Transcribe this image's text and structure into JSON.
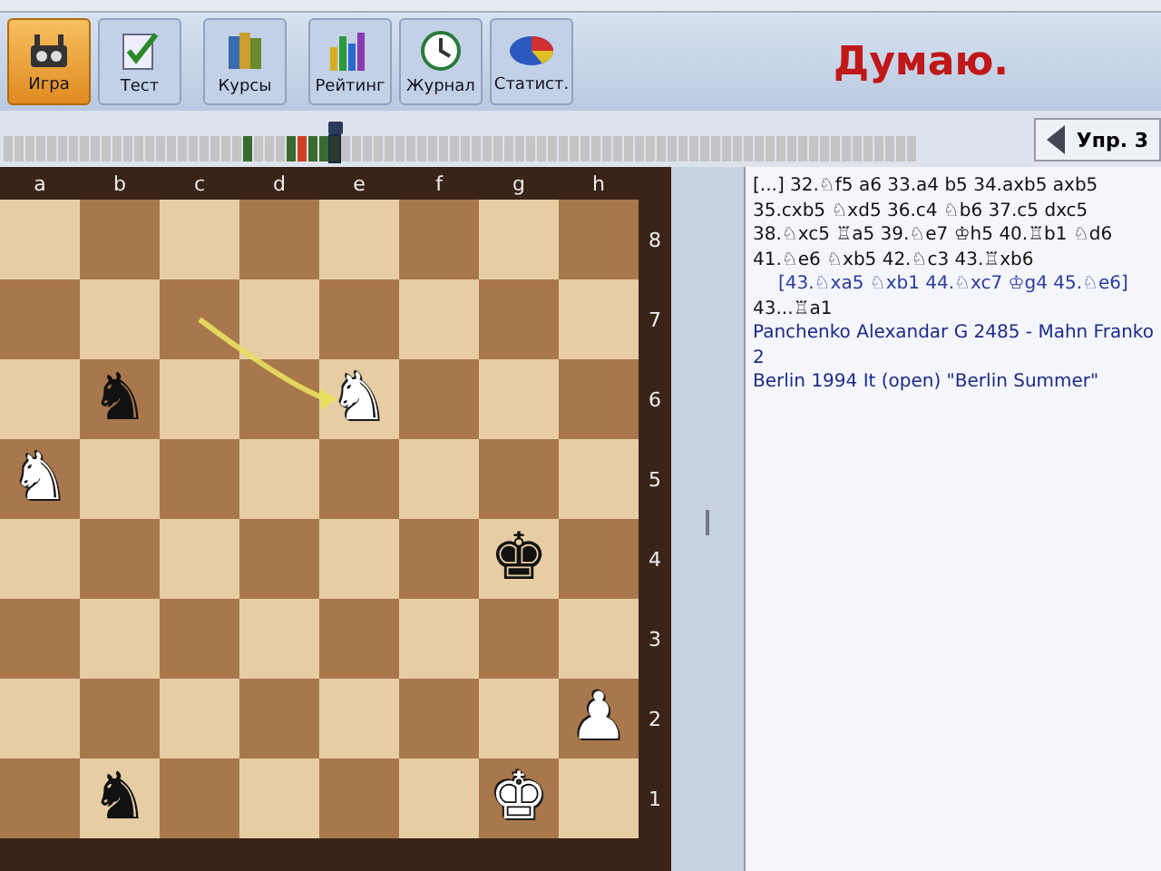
{
  "toolbar": {
    "buttons": [
      {
        "kind": "game",
        "label": "Игра",
        "selected": true
      },
      {
        "kind": "test",
        "label": "Тест",
        "selected": false
      },
      {
        "kind": "courses",
        "label": "Курсы",
        "selected": false
      },
      {
        "kind": "rating",
        "label": "Рейтинг",
        "selected": false
      },
      {
        "kind": "journal",
        "label": "Журнал",
        "selected": false
      },
      {
        "kind": "stats",
        "label": "Статист.",
        "selected": false
      }
    ],
    "status": "Думаю."
  },
  "move_strip": {
    "cells": [
      {
        "color": "#c4c4c4",
        "selected": false
      },
      {
        "color": "#c4c4c4",
        "selected": false
      },
      {
        "color": "#c4c4c4",
        "selected": false
      },
      {
        "color": "#c4c4c4",
        "selected": false
      },
      {
        "color": "#c4c4c4",
        "selected": false
      },
      {
        "color": "#c4c4c4",
        "selected": false
      },
      {
        "color": "#c4c4c4",
        "selected": false
      },
      {
        "color": "#c4c4c4",
        "selected": false
      },
      {
        "color": "#c4c4c4",
        "selected": false
      },
      {
        "color": "#c4c4c4",
        "selected": false
      },
      {
        "color": "#c4c4c4",
        "selected": false
      },
      {
        "color": "#c4c4c4",
        "selected": false
      },
      {
        "color": "#c4c4c4",
        "selected": false
      },
      {
        "color": "#c4c4c4",
        "selected": false
      },
      {
        "color": "#c4c4c4",
        "selected": false
      },
      {
        "color": "#c4c4c4",
        "selected": false
      },
      {
        "color": "#c4c4c4",
        "selected": false
      },
      {
        "color": "#c4c4c4",
        "selected": false
      },
      {
        "color": "#c4c4c4",
        "selected": false
      },
      {
        "color": "#c4c4c4",
        "selected": false
      },
      {
        "color": "#c4c4c4",
        "selected": false
      },
      {
        "color": "#c4c4c4",
        "selected": false
      },
      {
        "color": "#3a6a30",
        "selected": false
      },
      {
        "color": "#c4c4c4",
        "selected": false
      },
      {
        "color": "#c4c4c4",
        "selected": false
      },
      {
        "color": "#c4c4c4",
        "selected": false
      },
      {
        "color": "#3a6a30",
        "selected": false
      },
      {
        "color": "#d04020",
        "selected": false
      },
      {
        "color": "#3a6a30",
        "selected": false
      },
      {
        "color": "#3a6a30",
        "selected": false
      },
      {
        "color": "#2c3c2c",
        "selected": true
      },
      {
        "color": "#c4c4c4",
        "selected": false
      },
      {
        "color": "#c4c4c4",
        "selected": false
      },
      {
        "color": "#c4c4c4",
        "selected": false
      },
      {
        "color": "#c4c4c4",
        "selected": false
      },
      {
        "color": "#c4c4c4",
        "selected": false
      },
      {
        "color": "#c4c4c4",
        "selected": false
      },
      {
        "color": "#c4c4c4",
        "selected": false
      },
      {
        "color": "#c4c4c4",
        "selected": false
      },
      {
        "color": "#c4c4c4",
        "selected": false
      },
      {
        "color": "#c4c4c4",
        "selected": false
      },
      {
        "color": "#c4c4c4",
        "selected": false
      },
      {
        "color": "#c4c4c4",
        "selected": false
      },
      {
        "color": "#c4c4c4",
        "selected": false
      },
      {
        "color": "#c4c4c4",
        "selected": false
      },
      {
        "color": "#c4c4c4",
        "selected": false
      },
      {
        "color": "#c4c4c4",
        "selected": false
      },
      {
        "color": "#c4c4c4",
        "selected": false
      },
      {
        "color": "#c4c4c4",
        "selected": false
      },
      {
        "color": "#c4c4c4",
        "selected": false
      },
      {
        "color": "#c4c4c4",
        "selected": false
      },
      {
        "color": "#c4c4c4",
        "selected": false
      },
      {
        "color": "#c4c4c4",
        "selected": false
      },
      {
        "color": "#c4c4c4",
        "selected": false
      },
      {
        "color": "#c4c4c4",
        "selected": false
      },
      {
        "color": "#c4c4c4",
        "selected": false
      },
      {
        "color": "#c4c4c4",
        "selected": false
      },
      {
        "color": "#c4c4c4",
        "selected": false
      },
      {
        "color": "#c4c4c4",
        "selected": false
      },
      {
        "color": "#c4c4c4",
        "selected": false
      },
      {
        "color": "#c4c4c4",
        "selected": false
      },
      {
        "color": "#c4c4c4",
        "selected": false
      },
      {
        "color": "#c4c4c4",
        "selected": false
      },
      {
        "color": "#c4c4c4",
        "selected": false
      },
      {
        "color": "#c4c4c4",
        "selected": false
      },
      {
        "color": "#c4c4c4",
        "selected": false
      },
      {
        "color": "#c4c4c4",
        "selected": false
      },
      {
        "color": "#c4c4c4",
        "selected": false
      },
      {
        "color": "#c4c4c4",
        "selected": false
      },
      {
        "color": "#c4c4c4",
        "selected": false
      },
      {
        "color": "#c4c4c4",
        "selected": false
      },
      {
        "color": "#c4c4c4",
        "selected": false
      },
      {
        "color": "#c4c4c4",
        "selected": false
      },
      {
        "color": "#c4c4c4",
        "selected": false
      },
      {
        "color": "#c4c4c4",
        "selected": false
      },
      {
        "color": "#c4c4c4",
        "selected": false
      },
      {
        "color": "#c4c4c4",
        "selected": false
      },
      {
        "color": "#c4c4c4",
        "selected": false
      },
      {
        "color": "#c4c4c4",
        "selected": false
      },
      {
        "color": "#c4c4c4",
        "selected": false
      },
      {
        "color": "#c4c4c4",
        "selected": false
      },
      {
        "color": "#c4c4c4",
        "selected": false
      },
      {
        "color": "#c4c4c4",
        "selected": false
      },
      {
        "color": "#c4c4c4",
        "selected": false
      }
    ],
    "button": {
      "label": "Упр. 3"
    }
  },
  "board": {
    "files": [
      "a",
      "b",
      "c",
      "d",
      "e",
      "f",
      "g",
      "h"
    ],
    "ranks": [
      "8",
      "7",
      "6",
      "5",
      "4",
      "3",
      "2",
      "1"
    ],
    "rows": [
      [
        null,
        null,
        null,
        null,
        null,
        null,
        null,
        null
      ],
      [
        null,
        null,
        {
          "arrow_start": true
        },
        null,
        null,
        null,
        null,
        null
      ],
      [
        null,
        {
          "glyph": "♞",
          "white": false
        },
        null,
        null,
        {
          "glyph": "♞",
          "white": true,
          "arrow_end": true
        },
        null,
        null,
        null
      ],
      [
        {
          "glyph": "♞",
          "white": true
        },
        null,
        null,
        null,
        null,
        null,
        null,
        null
      ],
      [
        null,
        null,
        null,
        null,
        null,
        null,
        {
          "glyph": "♚",
          "white": false
        },
        null
      ],
      [
        null,
        null,
        null,
        null,
        null,
        null,
        null,
        null
      ],
      [
        null,
        null,
        null,
        null,
        null,
        null,
        null,
        {
          "glyph": "♟",
          "white": true
        }
      ],
      [
        null,
        {
          "glyph": "♞",
          "white": false
        },
        null,
        null,
        null,
        null,
        {
          "glyph": "♚",
          "white": true
        },
        null
      ]
    ]
  },
  "notation": {
    "moves": "[...] 32.♘f5 a6 33.a4 b5 34.axb5 axb5 35.cxb5 ♘xd5 36.c4 ♘b6 37.c5 dxc5 38.♘xc5 ♖a5 39.♘e7 ♔h5 40.♖b1 ♘d6 41.♘e6 ♘xb5 42.♘c3 43.♖xb6",
    "variation": "[43.♘xa5 ♘xb1 44.♘xc7 ♔g4 45.♘e6]",
    "continuation": "43...♖a1",
    "players": "Panchenko Alexandar G 2485 - Mahn Franko 2",
    "event": "Berlin 1994 It (open) \"Berlin Summer\""
  }
}
